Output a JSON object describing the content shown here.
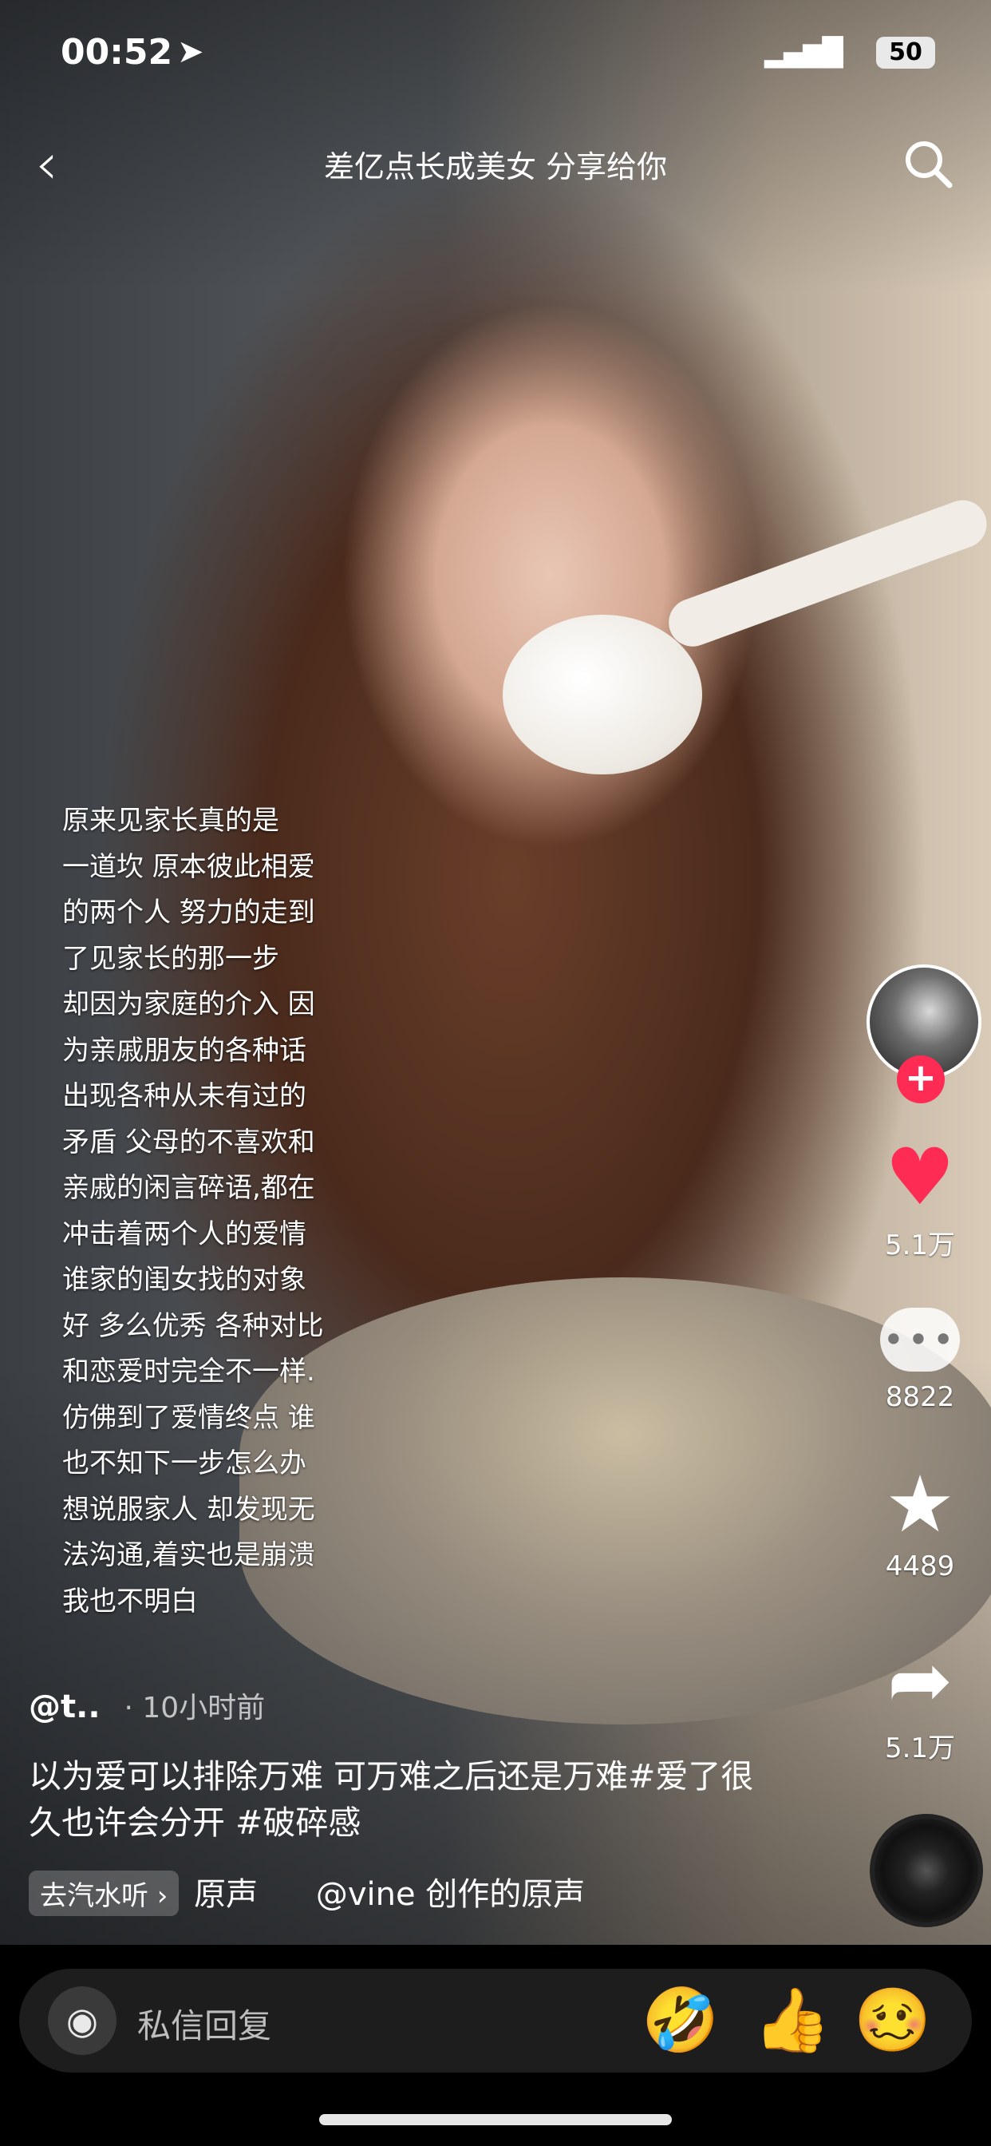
{
  "status_bar": {
    "time": "00:52",
    "location_icon": "location-arrow-icon",
    "battery": "50"
  },
  "top_bar": {
    "back_icon": "chevron-left-icon",
    "title": "差亿点长成美女 分享给你",
    "search_icon": "search-icon"
  },
  "overlay_text": "原来见家长真的是\n一道坎  原本彼此相爱\n的两个人 努力的走到\n了见家长的那一步\n却因为家庭的介入 因\n为亲戚朋友的各种话\n出现各种从未有过的\n矛盾 父母的不喜欢和\n亲戚的闲言碎语,都在\n冲击着两个人的爱情\n谁家的闺女找的对象\n好 多么优秀 各种对比\n和恋爱时完全不一样.\n仿佛到了爱情终点 谁\n也不知下一步怎么办\n想说服家人 却发现无\n法沟通,着实也是崩溃\n我也不明白",
  "actions": {
    "follow": "+",
    "likes": "5.1万",
    "comments": "8822",
    "favorites": "4489",
    "shares": "5.1万"
  },
  "post": {
    "author": "@t..",
    "time_ago": "· 10小时前",
    "caption": "以为爱可以排除万难 可万难之后还是万难#爱了很久也许会分开 #破碎感",
    "chip_label": "去汽水听 ›",
    "sound_src": "原声",
    "sound_name": "@vine 创作的原声"
  },
  "reply_bar": {
    "placeholder": "私信回复",
    "emojis": [
      "🤣",
      "👍",
      "🥴"
    ]
  }
}
